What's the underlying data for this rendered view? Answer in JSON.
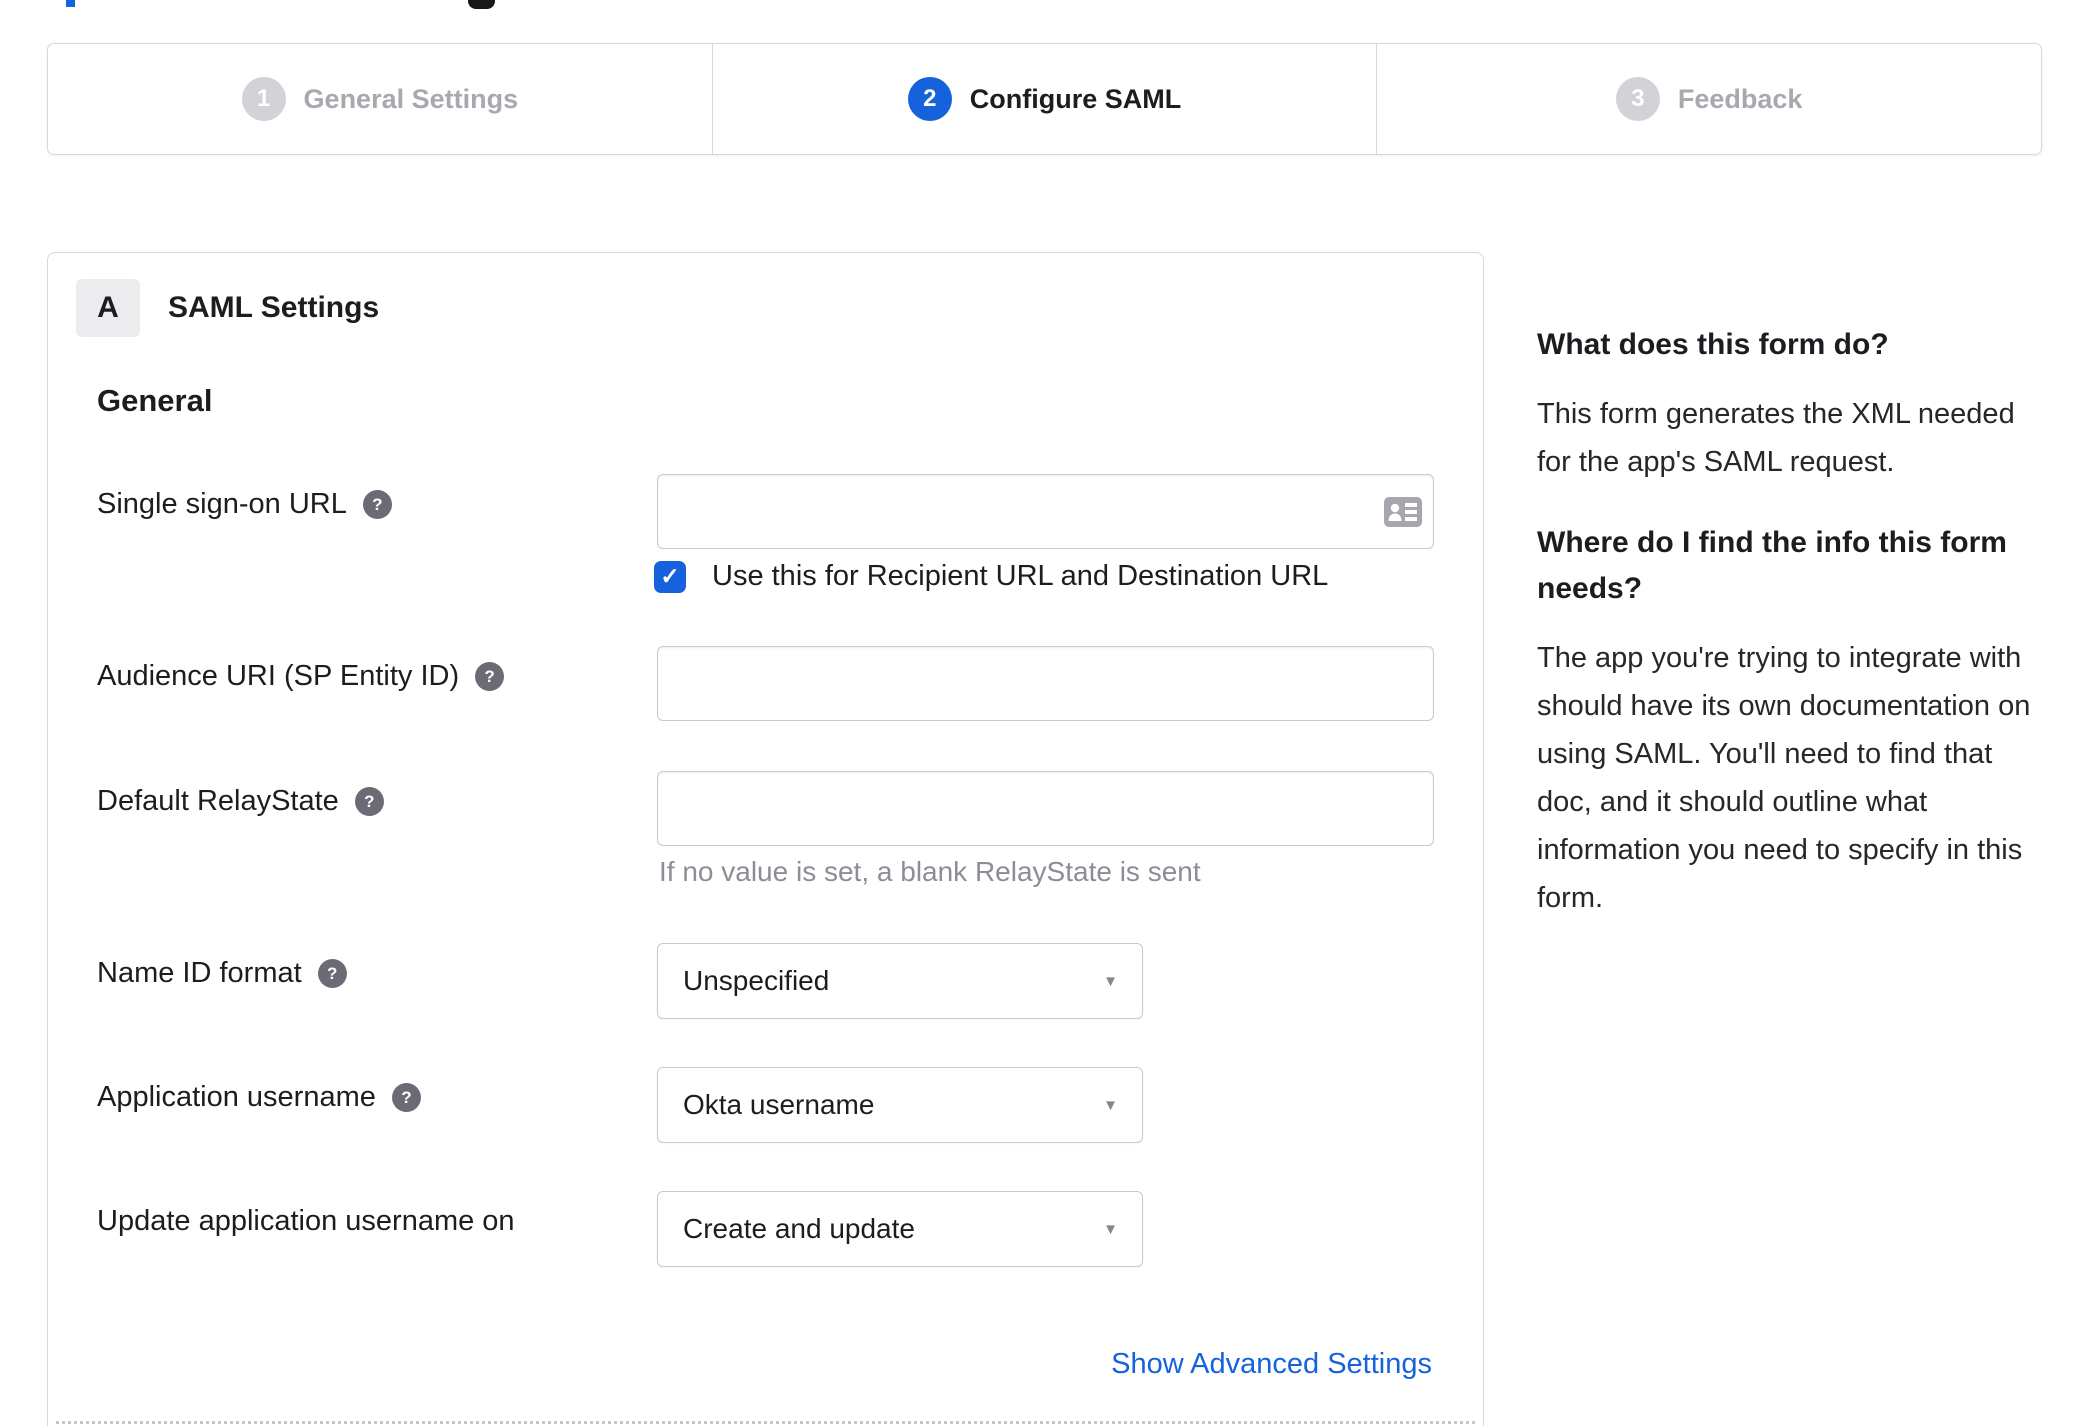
{
  "colors": {
    "accent_blue": "#1662dd",
    "text_dark": "#1d1d21",
    "inactive_gray": "#a8a8ae",
    "hint_gray": "#8d8d95",
    "border_gray": "#d8d8dc"
  },
  "icons": {
    "help": "?",
    "caret": "▼",
    "check": "✓"
  },
  "stepper": {
    "steps": [
      {
        "number": "1",
        "label": "General Settings",
        "active": false
      },
      {
        "number": "2",
        "label": "Configure SAML",
        "active": true
      },
      {
        "number": "3",
        "label": "Feedback",
        "active": false
      }
    ]
  },
  "panel": {
    "section_badge": "A",
    "section_title": "SAML Settings",
    "group_title": "General",
    "fields": {
      "sso_url": {
        "label": "Single sign-on URL",
        "value": ""
      },
      "sso_checkbox": {
        "label": "Use this for Recipient URL and Destination URL",
        "checked": true
      },
      "audience_uri": {
        "label": "Audience URI (SP Entity ID)",
        "value": ""
      },
      "default_relay_state": {
        "label": "Default RelayState",
        "value": "",
        "hint": "If no value is set, a blank RelayState is sent"
      },
      "name_id_format": {
        "label": "Name ID format",
        "value": "Unspecified"
      },
      "application_username": {
        "label": "Application username",
        "value": "Okta username"
      },
      "update_app_username": {
        "label": "Update application username on",
        "value": "Create and update"
      }
    },
    "advanced_link": "Show Advanced Settings"
  },
  "sidebar": {
    "heading_1": "What does this form do?",
    "body_1": "This form generates the XML needed\nfor the app's SAML request.",
    "heading_2": "Where do I find the info this form\nneeds?",
    "body_2": "The app you're trying to integrate with\nshould have its own documentation on\nusing SAML. You'll need to find that\ndoc, and it should outline what\ninformation you need to specify in this\nform."
  }
}
